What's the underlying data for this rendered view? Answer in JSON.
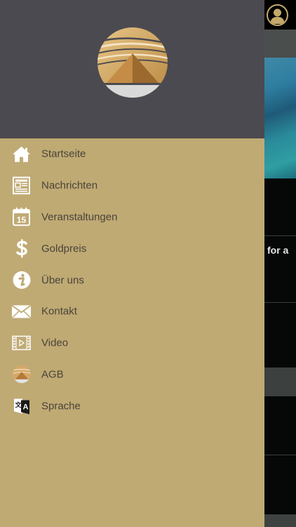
{
  "background": {
    "partial_text": "for a"
  },
  "drawer": {
    "logo_icon": "pyramid-logo",
    "menu": [
      {
        "label": "Startseite",
        "icon": "home-icon"
      },
      {
        "label": "Nachrichten",
        "icon": "newspaper-icon"
      },
      {
        "label": "Veranstaltungen",
        "icon": "calendar-icon",
        "icon_text": "15"
      },
      {
        "label": "Goldpreis",
        "icon": "dollar-icon"
      },
      {
        "label": "Über uns",
        "icon": "info-icon"
      },
      {
        "label": "Kontakt",
        "icon": "mail-icon"
      },
      {
        "label": "Video",
        "icon": "film-icon"
      },
      {
        "label": "AGB",
        "icon": "logo-small-icon"
      },
      {
        "label": "Sprache",
        "icon": "translate-icon"
      }
    ]
  },
  "colors": {
    "drawer_bg": "#bfaa74",
    "header_bg": "#4b4a50",
    "text": "#4a4339",
    "accent": "#c4aa6a"
  }
}
